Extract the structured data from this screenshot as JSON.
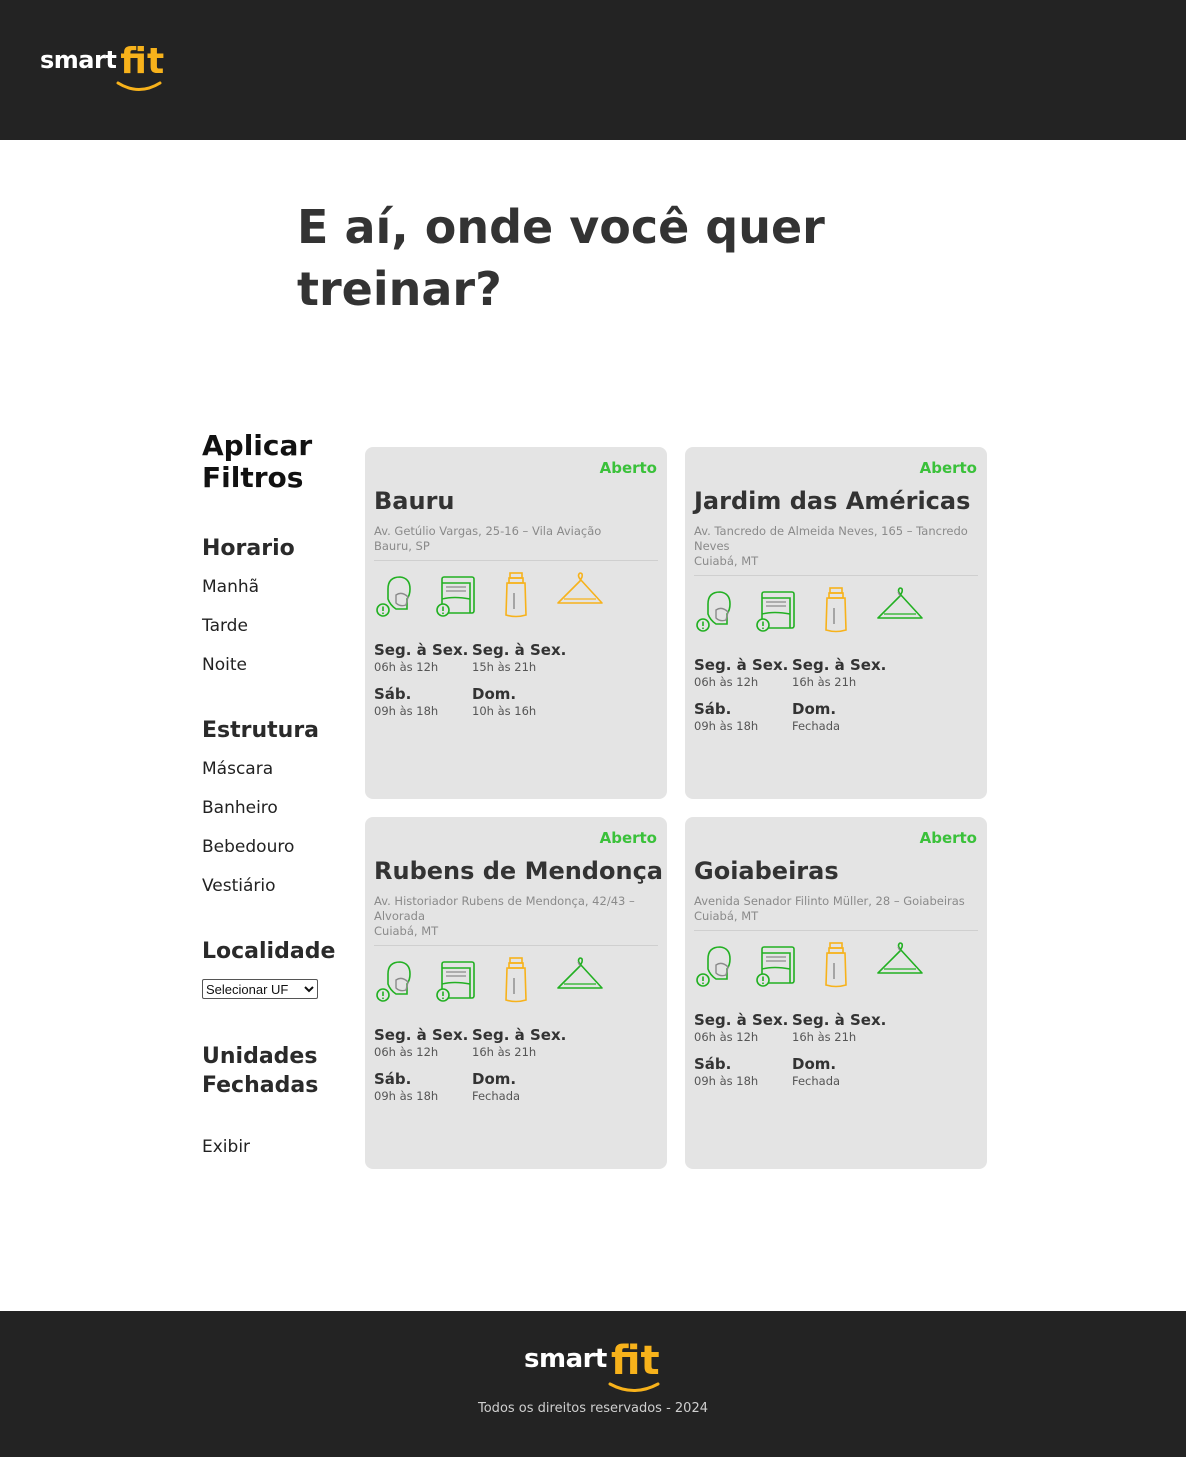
{
  "brand": {
    "smart": "smart",
    "fit": "fit",
    "accent": "#f7b21b"
  },
  "headline": "E aí, onde você quer treinar?",
  "filters": {
    "title": "Aplicar Filtros",
    "horario": {
      "label": "Horario",
      "options": [
        "Manhã",
        "Tarde",
        "Noite"
      ]
    },
    "estrutura": {
      "label": "Estrutura",
      "options": [
        "Máscara",
        "Banheiro",
        "Bebedouro",
        "Vestiário"
      ]
    },
    "localidade": {
      "label": "Localidade",
      "select_value": "Selecionar UF"
    },
    "fechadas": {
      "label": "Unidades Fechadas",
      "option": "Exibir"
    }
  },
  "units": [
    {
      "status": "Aberto",
      "name": "Bauru",
      "address": [
        "Av. Getúlio Vargas, 25-16 – Vila Aviação",
        "Bauru, SP"
      ],
      "icons": [
        "mask-required-icon",
        "towel-required-icon",
        "fountain-partial-icon",
        "lockers-partial-icon"
      ],
      "hours": [
        {
          "day": "Seg. à Sex.",
          "time": "06h às 12h"
        },
        {
          "day": "Seg. à Sex.",
          "time": "15h às 21h"
        },
        {
          "day": "Sáb.",
          "time": "09h às 18h"
        },
        {
          "day": "Dom.",
          "time": "10h às 16h"
        }
      ]
    },
    {
      "status": "Aberto",
      "name": "Jardim das Américas",
      "address": [
        "Av. Tancredo de Almeida Neves, 165 – Tancredo",
        "Neves",
        "Cuiabá, MT"
      ],
      "icons": [
        "mask-required-icon",
        "towel-required-icon",
        "fountain-partial-icon",
        "lockers-required-icon"
      ],
      "hours": [
        {
          "day": "Seg. à Sex.",
          "time": "06h às 12h"
        },
        {
          "day": "Seg. à Sex.",
          "time": "16h às 21h"
        },
        {
          "day": "Sáb.",
          "time": "09h às 18h"
        },
        {
          "day": "Dom.",
          "time": "Fechada"
        }
      ]
    },
    {
      "status": "Aberto",
      "name": "Rubens de Mendonça",
      "address": [
        "Av. Historiador Rubens de Mendonça, 42/43 –",
        "Alvorada",
        "Cuiabá, MT"
      ],
      "icons": [
        "mask-required-icon",
        "towel-required-icon",
        "fountain-partial-icon",
        "lockers-required-icon"
      ],
      "hours": [
        {
          "day": "Seg. à Sex.",
          "time": "06h às 12h"
        },
        {
          "day": "Seg. à Sex.",
          "time": "16h às 21h"
        },
        {
          "day": "Sáb.",
          "time": "09h às 18h"
        },
        {
          "day": "Dom.",
          "time": "Fechada"
        }
      ]
    },
    {
      "status": "Aberto",
      "name": "Goiabeiras",
      "address": [
        "Avenida Senador Filinto Müller, 28 – Goiabeiras",
        "Cuiabá, MT"
      ],
      "icons": [
        "mask-required-icon",
        "towel-required-icon",
        "fountain-partial-icon",
        "lockers-required-icon"
      ],
      "hours": [
        {
          "day": "Seg. à Sex.",
          "time": "06h às 12h"
        },
        {
          "day": "Seg. à Sex.",
          "time": "16h às 21h"
        },
        {
          "day": "Sáb.",
          "time": "09h às 18h"
        },
        {
          "day": "Dom.",
          "time": "Fechada"
        }
      ]
    }
  ],
  "colors": {
    "open": "#3ac13a",
    "required": "#22b022",
    "partial": "#f7b21b",
    "dark": "#232323"
  },
  "footer": {
    "copyright": "Todos os direitos reservados - 2024"
  }
}
